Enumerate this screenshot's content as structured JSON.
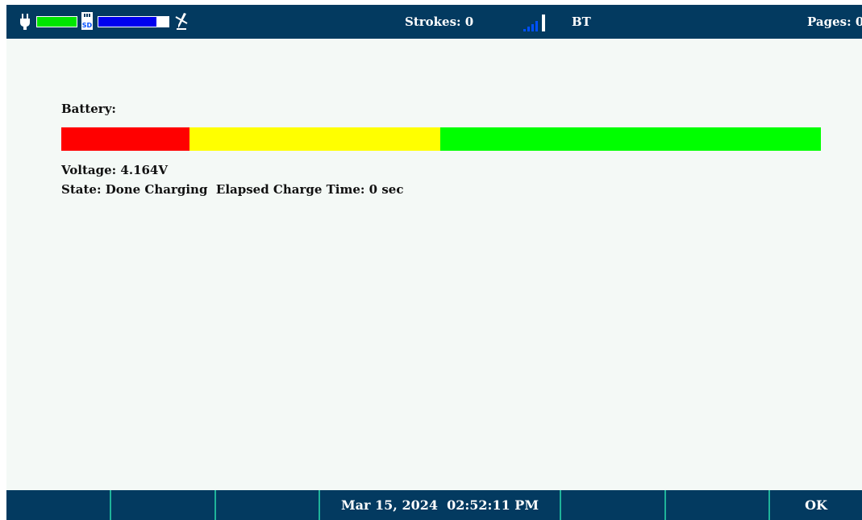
{
  "status_bar": {
    "power_icon": "plug-icon",
    "power_level_color": "#00e600",
    "sd_icon": "sd-card-icon",
    "sd_label": "SD",
    "storage_fill_fraction": 0.83,
    "storage_fill_color": "#0000ee",
    "pen_icon": "pen-disconnected-icon",
    "strokes": "Strokes: 0",
    "signal_icon": "signal-strength-icon",
    "signal_color": "#0050ff",
    "bt": "BT",
    "pages": "Pages: 0"
  },
  "battery": {
    "title": "Battery:",
    "segments": [
      {
        "color": "#ff0000",
        "fraction": 0.169
      },
      {
        "color": "#ffff00",
        "fraction": 0.33
      },
      {
        "color": "#00ff00",
        "fraction": 0.501
      }
    ],
    "voltage": "Voltage: 4.164V",
    "state": "State: Done Charging  Elapsed Charge Time: 0 sec"
  },
  "softkeys": {
    "key1": "",
    "key2": "",
    "key3": "",
    "datetime": "Mar 15, 2024  02:52:11 PM",
    "key5": "",
    "key6": "",
    "ok": "OK"
  },
  "colors": {
    "bar_background": "#033a60",
    "screen_background": "#f4f9f6",
    "softkey_divider": "#1fb39a"
  }
}
